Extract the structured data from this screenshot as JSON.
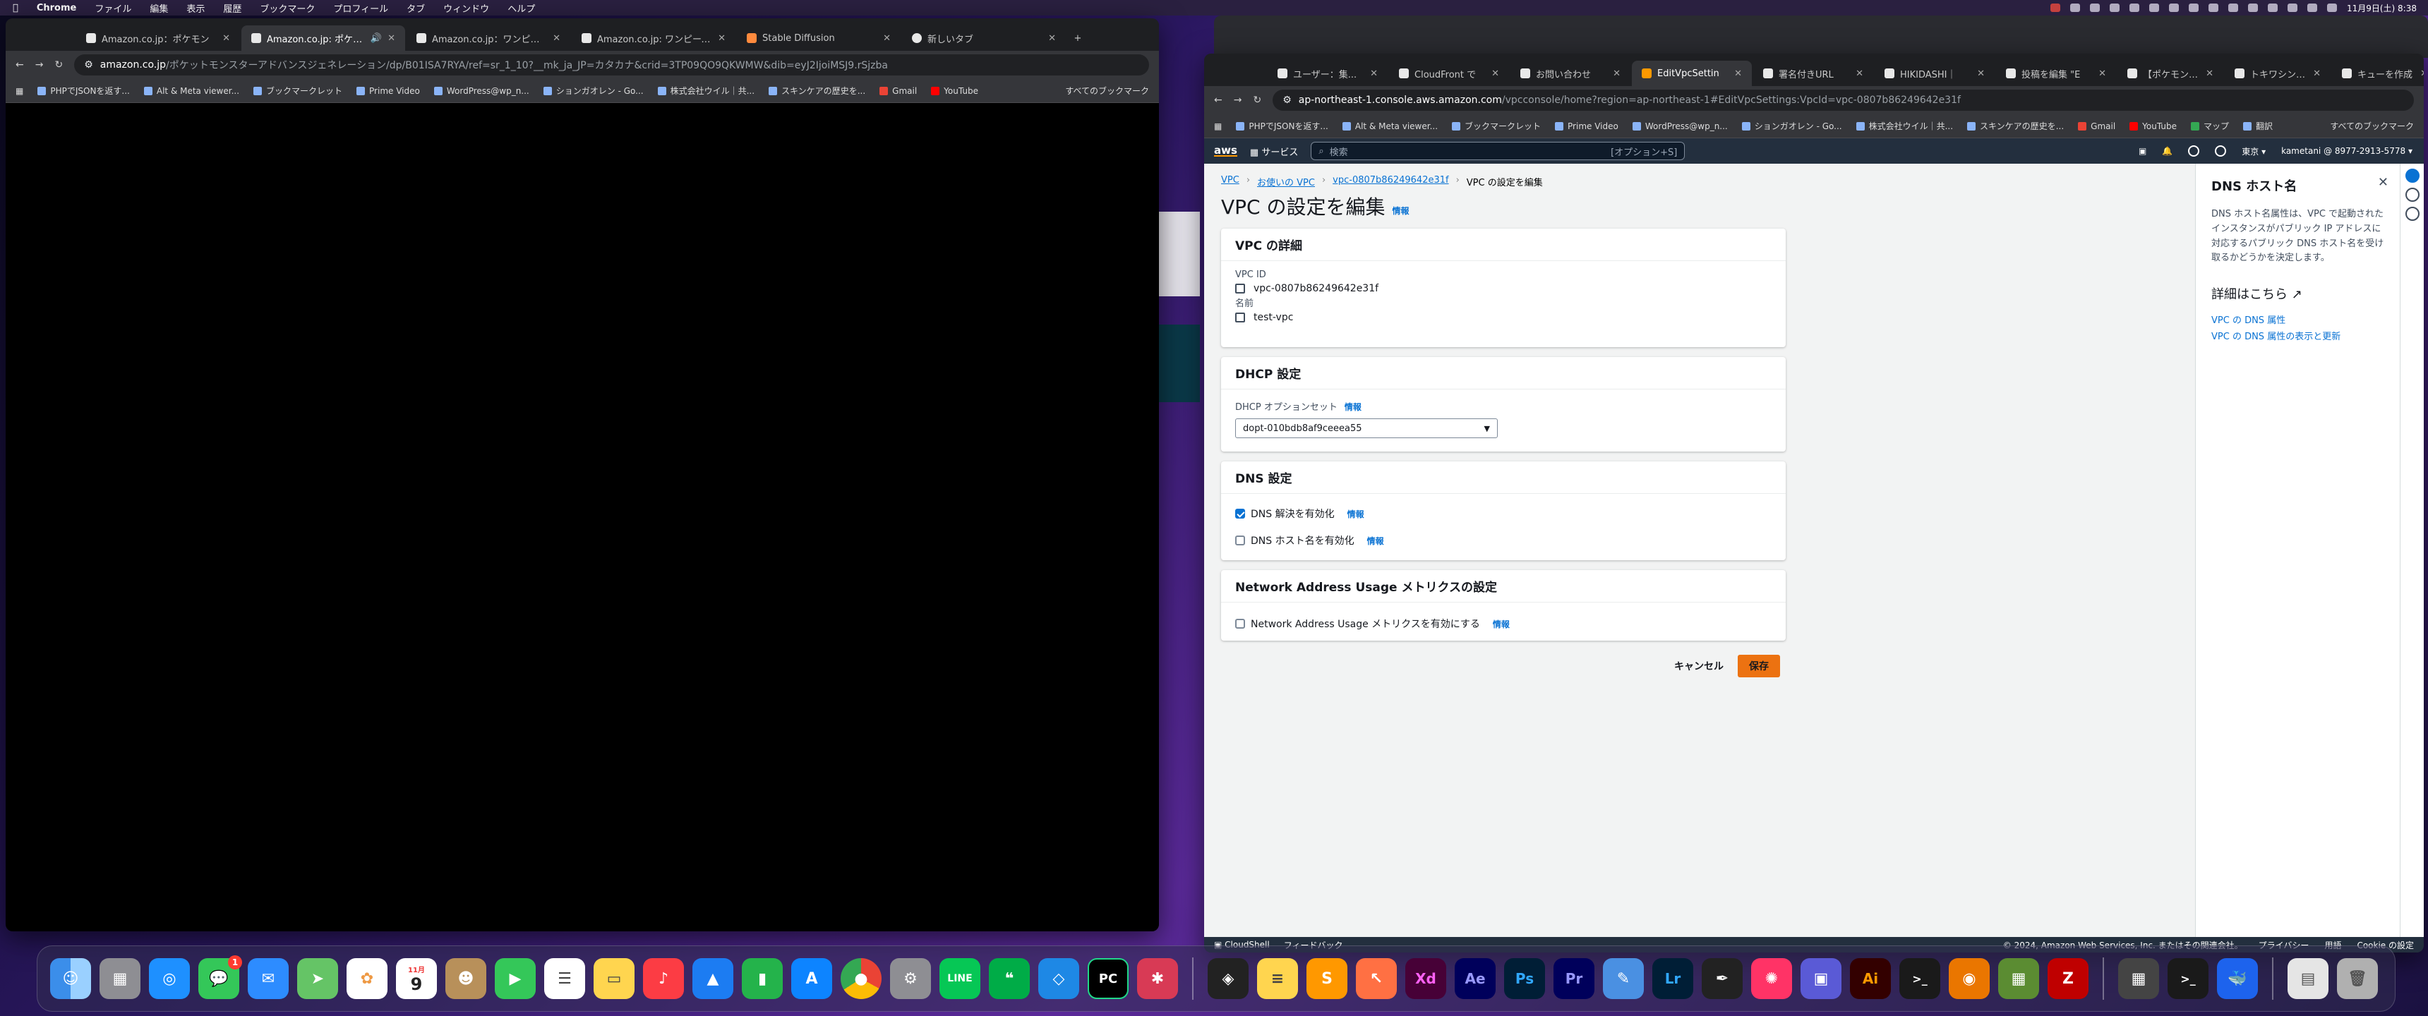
{
  "menubar": {
    "app": "Chrome",
    "items": [
      "ファイル",
      "編集",
      "表示",
      "履歴",
      "ブックマーク",
      "プロフィール",
      "タブ",
      "ウィンドウ",
      "ヘルプ"
    ],
    "clock": "11月9日(土) 8:38"
  },
  "left_window": {
    "tabs": [
      {
        "title": "Amazon.co.jp：ポケモン"
      },
      {
        "title": "Amazon.co.jp: ポケットモ"
      },
      {
        "title": "Amazon.co.jp：ワンピース ス"
      },
      {
        "title": "Amazon.co.jp: ワンピース ス"
      },
      {
        "title": "Stable Diffusion"
      },
      {
        "title": "新しいタブ"
      }
    ],
    "url_host": "amazon.co.jp",
    "url_path": "/ポケットモンスターアドバンスジェネレーション/dp/B01ISA7RYA/ref=sr_1_10?__mk_ja_JP=カタカナ&crid=3TP09QO9QKWMW&dib=eyJ2IjoiMSJ9.rSjzba",
    "bookmarks": [
      "PHPでJSONを返す...",
      "Alt & Meta viewer...",
      "ブックマークレット",
      "Prime Video",
      "WordPress@wp_n...",
      "ションガオレン - Go...",
      "株式会社ウイル｜共...",
      "スキンケアの歴史を...",
      "Gmail",
      "YouTube"
    ],
    "all_bookmarks": "すべてのブックマーク"
  },
  "right_window": {
    "tabs": [
      {
        "title": "ユーザー：集..."
      },
      {
        "title": "CloudFront で"
      },
      {
        "title": "お問い合わせ"
      },
      {
        "title": "EditVpcSettin"
      },
      {
        "title": "署名付きURL"
      },
      {
        "title": "HIKIDASHI｜"
      },
      {
        "title": "投稿を編集 \"E"
      },
      {
        "title": "【ポケモンSV"
      },
      {
        "title": "トキワシン ジ"
      },
      {
        "title": "キューを作成"
      }
    ],
    "url_host": "ap-northeast-1.console.aws.amazon.com",
    "url_path": "/vpcconsole/home?region=ap-northeast-1#EditVpcSettings:VpcId=vpc-0807b86249642e31f",
    "bookmarks": [
      "PHPでJSONを返す...",
      "Alt & Meta viewer...",
      "ブックマークレット",
      "Prime Video",
      "WordPress@wp_n...",
      "ションガオレン - Go...",
      "株式会社ウイル｜共...",
      "スキンケアの歴史を...",
      "Gmail",
      "YouTube",
      "マップ",
      "翻訳"
    ],
    "all_bookmarks": "すべてのブックマーク"
  },
  "aws": {
    "services": "サービス",
    "search_placeholder": "検索",
    "search_shortcut": "[オプション+S]",
    "region": "東京 ▾",
    "account": "kametani @ 8977-2913-5778 ▾",
    "breadcrumb": [
      "VPC",
      "お使いの VPC",
      "vpc-0807b86249642e31f",
      "VPC の設定を編集"
    ],
    "page_title": "VPC の設定を編集",
    "info": "情報",
    "vpc_details": {
      "heading": "VPC の詳細",
      "id_label": "VPC ID",
      "id_value": "vpc-0807b86249642e31f",
      "name_label": "名前",
      "name_value": "test-vpc"
    },
    "dhcp": {
      "heading": "DHCP 設定",
      "label": "DHCP オプションセット",
      "value": "dopt-010bdb8af9ceeea55"
    },
    "dns": {
      "heading": "DNS 設定",
      "resolution_label": "DNS 解決を有効化",
      "resolution_checked": true,
      "hostnames_label": "DNS ホスト名を有効化",
      "hostnames_checked": false
    },
    "nau": {
      "heading": "Network Address Usage メトリクスの設定",
      "label": "Network Address Usage メトリクスを有効にする",
      "checked": false
    },
    "cancel": "キャンセル",
    "save": "保存",
    "help": {
      "title": "DNS ホスト名",
      "body": "DNS ホスト名属性は、VPC で起動されたインスタンスがパブリック IP アドレスに対応するパブリック DNS ホスト名を受け取るかどうかを決定します。",
      "more": "詳細はこちら",
      "links": [
        "VPC の DNS 属性",
        "VPC の DNS 属性の表示と更新"
      ]
    },
    "footer": {
      "cloudshell": "CloudShell",
      "feedback": "フィードバック",
      "copyright": "© 2024, Amazon Web Services, Inc. またはその関連会社。",
      "privacy": "プライバシー",
      "terms": "用語",
      "cookie": "Cookie の設定"
    }
  },
  "dock": {
    "calendar_month": "11月",
    "calendar_day": "9",
    "messages_badge": "1",
    "apps": [
      "Finder",
      "Launchpad",
      "Safari",
      "メッセージ",
      "メール",
      "マップ",
      "写真",
      "カレンダー",
      "連絡先",
      "FaceTime",
      "リマインダー",
      "メモ",
      "ミュージック",
      "Keynote",
      "Numbers",
      "App Store",
      "Chrome",
      "システム設定",
      "LINE",
      "Google Chat",
      "VS Code",
      "PyCharm",
      "Photo Booth",
      "DaVinci Resolve",
      "Notes",
      "Sublime",
      "Transmit",
      "XD",
      "After Effects",
      "Photoshop",
      "Premiere Pro",
      "Markup",
      "Lightroom",
      "Inkscape",
      "Clock",
      "Apple Configurator",
      "Illustrator",
      "ターミナル",
      "Blender",
      "Minecraft",
      "FileZilla",
      "電卓",
      "ターミナル",
      "Docker"
    ]
  },
  "colors": {
    "aws_nav": "#232f3e",
    "aws_link": "#0972d3",
    "aws_save": "#ec7211"
  }
}
